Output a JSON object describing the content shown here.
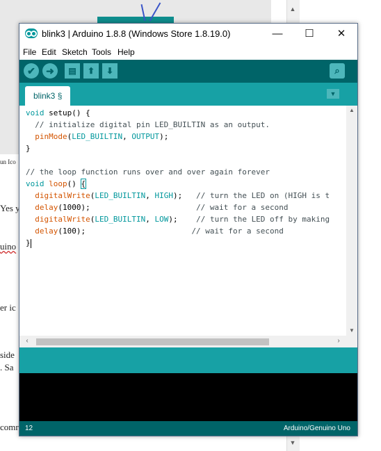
{
  "window": {
    "title": "blink3 | Arduino 1.8.8 (Windows Store 1.8.19.0)",
    "controls": {
      "minimize": "—",
      "maximize": "☐",
      "close": "✕"
    }
  },
  "menu": [
    "File",
    "Edit",
    "Sketch",
    "Tools",
    "Help"
  ],
  "toolbar": {
    "verify_icon": "✔",
    "upload_icon": "➜",
    "new_icon": "▤",
    "open_icon": "⬆",
    "save_icon": "⬇",
    "serial_icon": "⌕"
  },
  "tabs": [
    {
      "label": "blink3 §"
    }
  ],
  "tab_menu_icon": "▼",
  "code": {
    "l1": {
      "kw": "void",
      "rest": " setup() {"
    },
    "l2": "  // initialize digital pin LED_BUILTIN as an output.",
    "l3": {
      "fn": "pinMode",
      "a": "(",
      "c1": "LED_BUILTIN",
      "b": ", ",
      "c2": "OUTPUT",
      "d": ");"
    },
    "l4": "}",
    "l6": "// the loop function runs over and over again forever",
    "l7": {
      "kw": "void",
      "fn": "loop",
      "rest": "() ",
      "brace": "{"
    },
    "l8": {
      "fn": "digitalWrite",
      "a": "(",
      "c1": "LED_BUILTIN",
      "b": ", ",
      "c2": "HIGH",
      "d": ");   ",
      "cm": "// turn the LED on (HIGH is t"
    },
    "l9": {
      "fn": "delay",
      "a": "(1000);                       ",
      "cm": "// wait for a second"
    },
    "l10": {
      "fn": "digitalWrite",
      "a": "(",
      "c1": "LED_BUILTIN",
      "b": ", ",
      "c2": "LOW",
      "d": ");    ",
      "cm": "// turn the LED off by making"
    },
    "l11": {
      "fn": "delay",
      "a": "(100);                       ",
      "cm": "// wait for a second"
    },
    "l12": "}"
  },
  "status": {
    "line": "12",
    "board": "Arduino/Genuino Uno"
  },
  "background_doc": {
    "lines": [
      "un Ico",
      "Yes y",
      "uino",
      "er ic",
      "side",
      ".  Sa",
      "comr"
    ]
  }
}
